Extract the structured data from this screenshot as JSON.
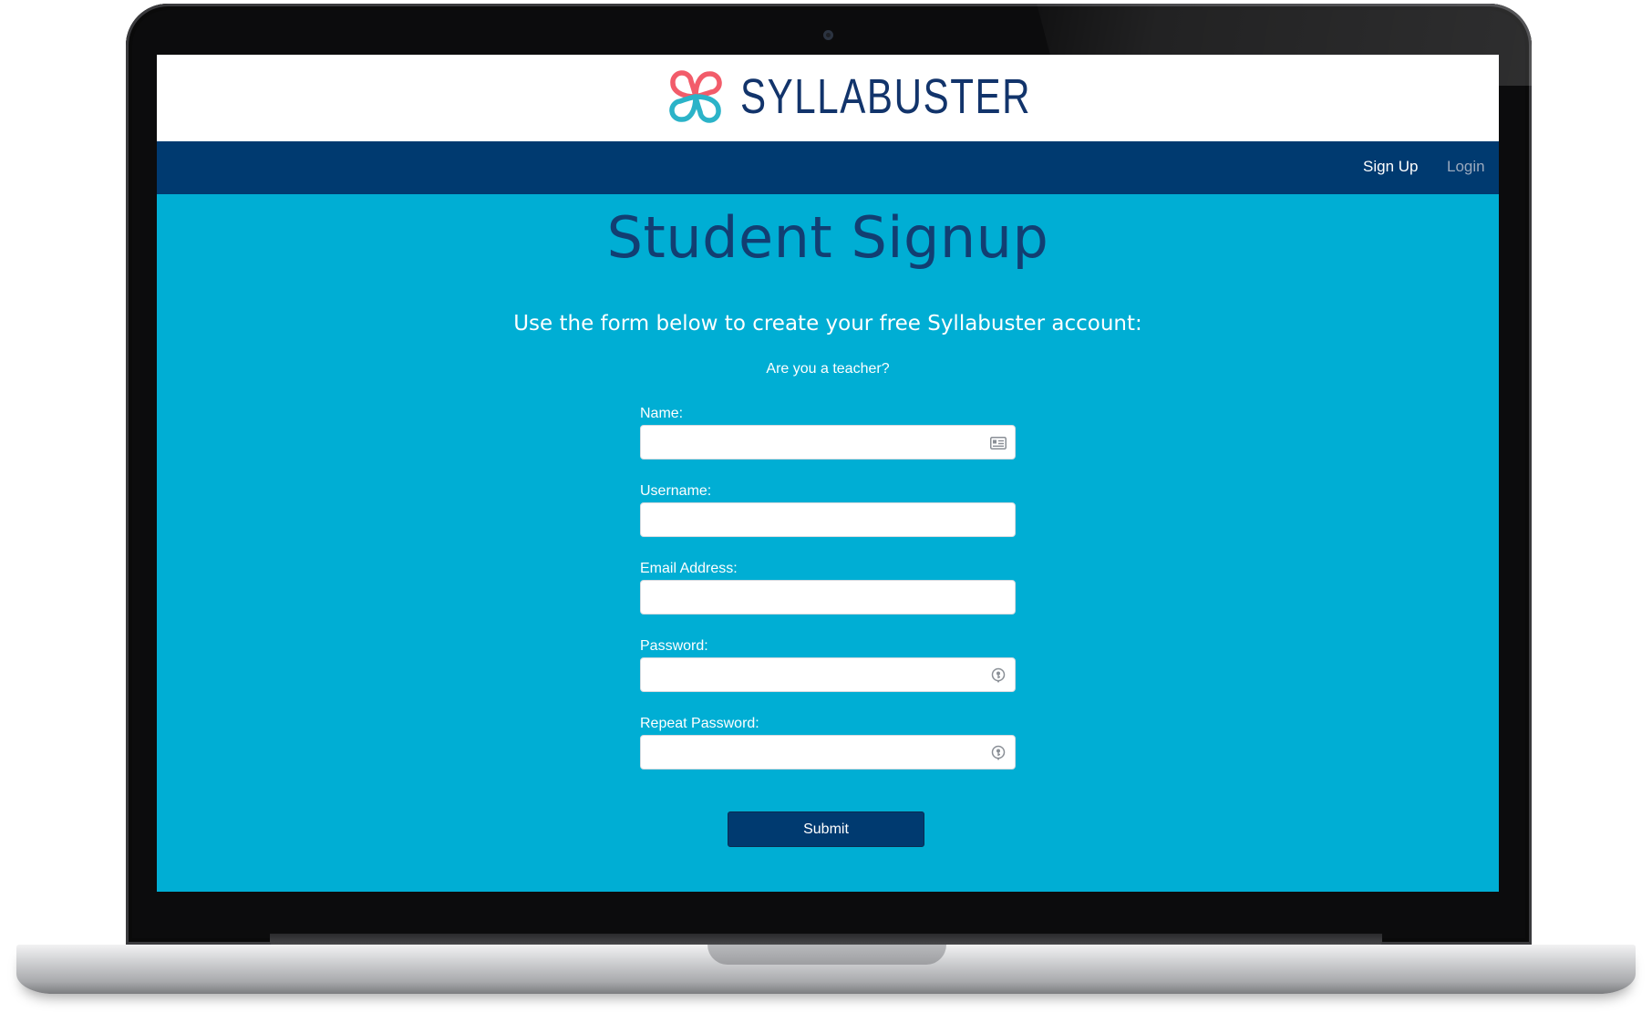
{
  "brand": {
    "name": "SYLLABUSTER",
    "logo_icon": "four-loop-flower-logo",
    "logo_colors": [
      "#f25c6a",
      "#2bb3c8"
    ]
  },
  "nav": {
    "items": [
      {
        "label": "Sign Up",
        "active": true
      },
      {
        "label": "Login",
        "active": false
      }
    ]
  },
  "page": {
    "title": "Student Signup",
    "intro": "Use the form below to create your free Syllabuster account:",
    "teacher_link": "Are you a teacher?"
  },
  "form": {
    "fields": [
      {
        "label": "Name:",
        "value": "",
        "icon": "contact-card-icon"
      },
      {
        "label": "Username:",
        "value": "",
        "icon": ""
      },
      {
        "label": "Email Address:",
        "value": "",
        "icon": ""
      },
      {
        "label": "Password:",
        "value": "",
        "icon": "key-icon"
      },
      {
        "label": "Repeat Password:",
        "value": "",
        "icon": "key-icon"
      }
    ],
    "submit_label": "Submit"
  },
  "colors": {
    "page_background": "#00aed4",
    "navbar": "#003a70",
    "title": "#123e72",
    "button": "#003a70"
  }
}
